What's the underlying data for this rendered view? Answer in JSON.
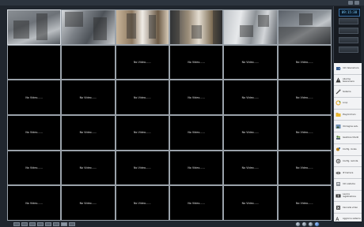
{
  "clock": "09:15:38",
  "side_buttons": [
    "",
    "",
    "",
    ""
  ],
  "grid": {
    "rows": 6,
    "cols": 6,
    "no_video_text": "No Video......",
    "cameras": [
      {
        "index": 0,
        "kind": "cam1"
      },
      {
        "index": 1,
        "kind": "cam2"
      },
      {
        "index": 2,
        "kind": "cam3"
      },
      {
        "index": 3,
        "kind": "cam4"
      },
      {
        "index": 4,
        "kind": "cam5"
      },
      {
        "index": 5,
        "kind": "cam6"
      }
    ],
    "labeled_empty": [
      {
        "index": 6,
        "label": "",
        "tag": ""
      },
      {
        "index": 7,
        "label": "",
        "tag": ""
      }
    ]
  },
  "menu": [
    {
      "label": "Info telecamera",
      "icon": "camera-info-icon"
    },
    {
      "label": "Allarme telecamera",
      "icon": "alarm-icon"
    },
    {
      "label": "Sistema",
      "icon": "tools-icon"
    },
    {
      "label": "Loop",
      "icon": "loop-icon"
    },
    {
      "label": "Play/Archivio",
      "icon": "folder-icon"
    },
    {
      "label": "Immagine salv.",
      "icon": "image-icon"
    },
    {
      "label": "Gestione Utenti",
      "icon": "users-icon"
    },
    {
      "label": "Config. locale",
      "icon": "config-icon"
    },
    {
      "label": "Config. remota",
      "icon": "remote-config-icon"
    },
    {
      "label": "IP Camera",
      "icon": "ip-camera-icon"
    },
    {
      "label": "Info sistema",
      "icon": "system-info-icon"
    },
    {
      "label": "Lavora registrazione",
      "icon": "record-icon"
    },
    {
      "label": "Cancella video",
      "icon": "erase-icon"
    },
    {
      "label": "Aggiorna sistema",
      "icon": "update-icon"
    }
  ],
  "layout_buttons": 8,
  "active_layout": 7,
  "ptz_buttons": [
    "left",
    "home",
    "right",
    "blue"
  ]
}
